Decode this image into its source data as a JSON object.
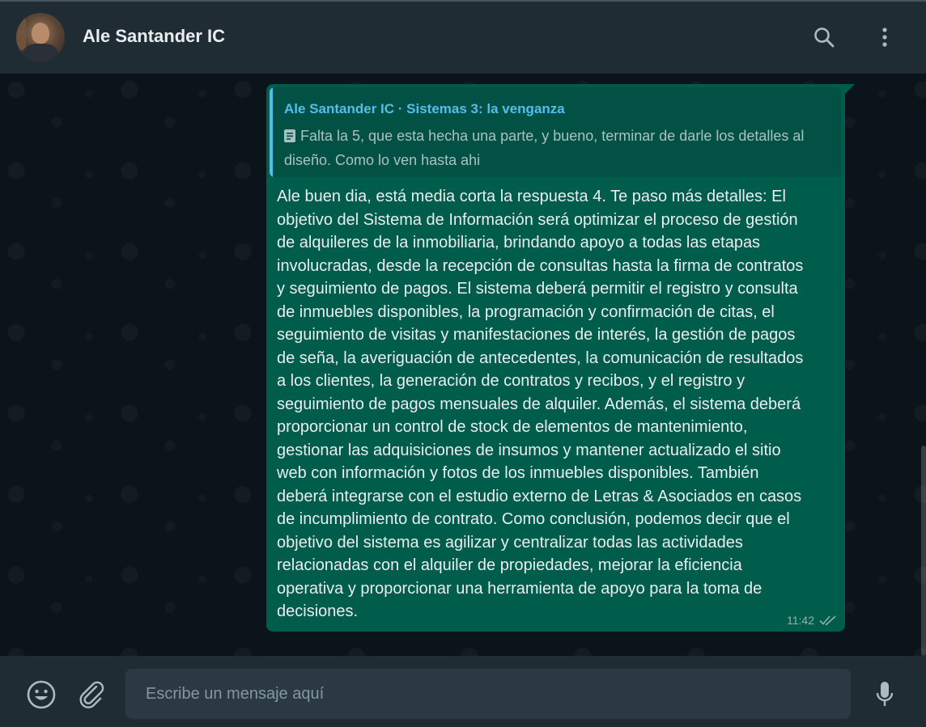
{
  "header": {
    "contact_name": "Ale Santander IC",
    "avatar_icon": "contact-avatar",
    "icons": [
      "search-icon",
      "menu-dots-icon"
    ]
  },
  "message": {
    "quote": {
      "author": "Ale Santander IC · Sistemas 3: la venganza",
      "icon": "document-icon",
      "text": "Falta la 5, que esta hecha una parte, y bueno, terminar de darle los detalles al diseño. Como lo ven hasta ahi"
    },
    "lines": [
      "Ale buen dia, está media corta la respuesta 4. Te paso más detalles: El",
      "objetivo del Sistema de Información será optimizar el proceso de gestión",
      "de alquileres de la inmobiliaria, brindando apoyo a todas las etapas",
      "involucradas, desde la recepción de consultas hasta la firma de contratos",
      "y seguimiento de pagos. El sistema deberá permitir el registro y consulta",
      "de inmuebles disponibles, la programación y confirmación de citas, el",
      "seguimiento de visitas y manifestaciones de interés, la gestión de pagos",
      "de seña, la averiguación de antecedentes, la comunicación de resultados",
      "a los clientes, la generación de contratos y recibos, y el registro y",
      "seguimiento de pagos mensuales de alquiler. Además, el sistema deberá",
      "proporcionar un control de stock de elementos de mantenimiento,",
      "gestionar las adquisiciones de insumos y mantener actualizado el sitio",
      "web con información y fotos de los inmuebles disponibles. También",
      "deberá integrarse con el estudio externo de Letras & Asociados en casos",
      "de incumplimiento de contrato. Como conclusión, podemos decir que el",
      "objetivo del sistema es agilizar y centralizar todas las actividades",
      "relacionadas con el alquiler de propiedades, mejorar la eficiencia",
      "operativa y proporcionar una herramienta de apoyo para la toma de",
      "decisiones."
    ],
    "time": "11:42",
    "status_icon": "double-check-icon"
  },
  "composer": {
    "placeholder": "Escribe un mensaje aquí",
    "icons": [
      "emoji-icon",
      "attach-icon",
      "mic-icon"
    ]
  },
  "colors": {
    "header_bg": "#202c33",
    "chat_bg": "#0b141a",
    "bubble_bg": "#005c4b",
    "quote_accent": "#53bdeb",
    "text": "#e9edef",
    "muted": "#8696a0"
  }
}
